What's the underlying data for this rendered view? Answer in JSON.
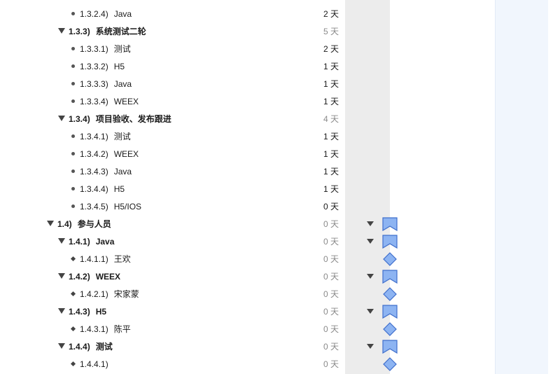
{
  "duration_unit": "天",
  "colors": {
    "milestone_fill": "#8db4f2",
    "milestone_stroke": "#3f6fcc",
    "column_shade": "#ececec",
    "right_pane": "#f1f6fd"
  },
  "rows": [
    {
      "num": "1.3.2.4)",
      "name": "Java",
      "dur": "2 天",
      "depth": 3,
      "kind": "task"
    },
    {
      "num": "1.3.3)",
      "name": "系统测试二轮",
      "dur": "5 天",
      "depth": 2,
      "kind": "group",
      "gray": true
    },
    {
      "num": "1.3.3.1)",
      "name": "测试",
      "dur": "2 天",
      "depth": 3,
      "kind": "task"
    },
    {
      "num": "1.3.3.2)",
      "name": "H5",
      "dur": "1 天",
      "depth": 3,
      "kind": "task"
    },
    {
      "num": "1.3.3.3)",
      "name": "Java",
      "dur": "1 天",
      "depth": 3,
      "kind": "task"
    },
    {
      "num": "1.3.3.4)",
      "name": "WEEX",
      "dur": "1 天",
      "depth": 3,
      "kind": "task"
    },
    {
      "num": "1.3.4)",
      "name": "项目验收、发布跟进",
      "dur": "4 天",
      "depth": 2,
      "kind": "group",
      "gray": true
    },
    {
      "num": "1.3.4.1)",
      "name": "测试",
      "dur": "1 天",
      "depth": 3,
      "kind": "task"
    },
    {
      "num": "1.3.4.2)",
      "name": "WEEX",
      "dur": "1 天",
      "depth": 3,
      "kind": "task"
    },
    {
      "num": "1.3.4.3)",
      "name": "Java",
      "dur": "1 天",
      "depth": 3,
      "kind": "task"
    },
    {
      "num": "1.3.4.4)",
      "name": "H5",
      "dur": "1 天",
      "depth": 3,
      "kind": "task"
    },
    {
      "num": "1.3.4.5)",
      "name": "H5/IOS",
      "dur": "0 天",
      "depth": 3,
      "kind": "task"
    },
    {
      "num": "1.4)",
      "name": "参与人员",
      "dur": "0 天",
      "depth": 1,
      "kind": "group",
      "gray": true,
      "gantt": "group"
    },
    {
      "num": "1.4.1)",
      "name": "Java",
      "dur": "0 天",
      "depth": 2,
      "kind": "group",
      "gray": true,
      "gantt": "group"
    },
    {
      "num": "1.4.1.1)",
      "name": "王欢",
      "dur": "0 天",
      "depth": 3,
      "kind": "milestone",
      "gray": true,
      "gantt": "milestone"
    },
    {
      "num": "1.4.2)",
      "name": "WEEX",
      "dur": "0 天",
      "depth": 2,
      "kind": "group",
      "gray": true,
      "gantt": "group"
    },
    {
      "num": "1.4.2.1)",
      "name": "宋家蒙",
      "dur": "0 天",
      "depth": 3,
      "kind": "milestone",
      "gray": true,
      "gantt": "milestone"
    },
    {
      "num": "1.4.3)",
      "name": "H5",
      "dur": "0 天",
      "depth": 2,
      "kind": "group",
      "gray": true,
      "gantt": "group"
    },
    {
      "num": "1.4.3.1)",
      "name": "陈平",
      "dur": "0 天",
      "depth": 3,
      "kind": "milestone",
      "gray": true,
      "gantt": "milestone"
    },
    {
      "num": "1.4.4)",
      "name": "测试",
      "dur": "0 天",
      "depth": 2,
      "kind": "group",
      "gray": true,
      "gantt": "group"
    },
    {
      "num": "1.4.4.1)",
      "name": "",
      "dur": "0 天",
      "depth": 3,
      "kind": "milestone",
      "gray": true,
      "gantt": "milestone"
    }
  ]
}
